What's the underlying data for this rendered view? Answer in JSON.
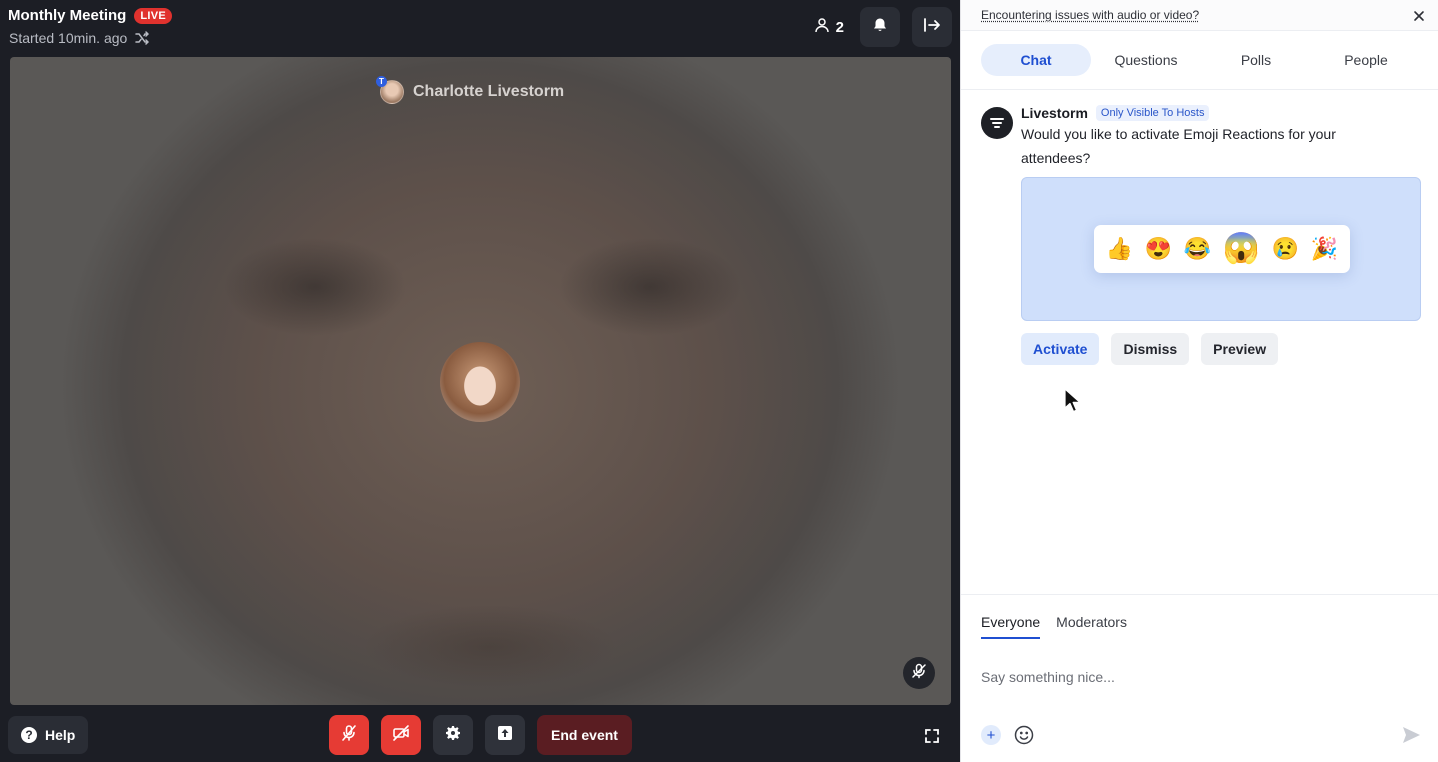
{
  "header": {
    "meeting_title": "Monthly Meeting",
    "live_label": "LIVE",
    "started_text": "Started 10min. ago",
    "participant_count": "2"
  },
  "video": {
    "speaker_name": "Charlotte Livestorm",
    "speaker_badge": "T"
  },
  "controls": {
    "help_label": "Help",
    "end_event_label": "End event"
  },
  "panel": {
    "notice_text": "Encountering issues with audio or video?",
    "tabs": [
      "Chat",
      "Questions",
      "Polls",
      "People"
    ],
    "active_tab": "Chat",
    "message": {
      "author": "Livestorm",
      "badge": "Only Visible To Hosts",
      "text": "Would you like to activate Emoji Reactions for your attendees?",
      "emojis": [
        "👍",
        "😍",
        "😂",
        "😱",
        "😢",
        "🎉"
      ],
      "actions": [
        "Activate",
        "Dismiss",
        "Preview"
      ]
    },
    "audience_tabs": [
      "Everyone",
      "Moderators"
    ],
    "compose_placeholder": "Say something nice..."
  },
  "colors": {
    "live_red": "#e0322e",
    "accent_blue": "#1f4fd1",
    "control_red": "#e63b34",
    "end_event_bg": "#5a1d22"
  }
}
